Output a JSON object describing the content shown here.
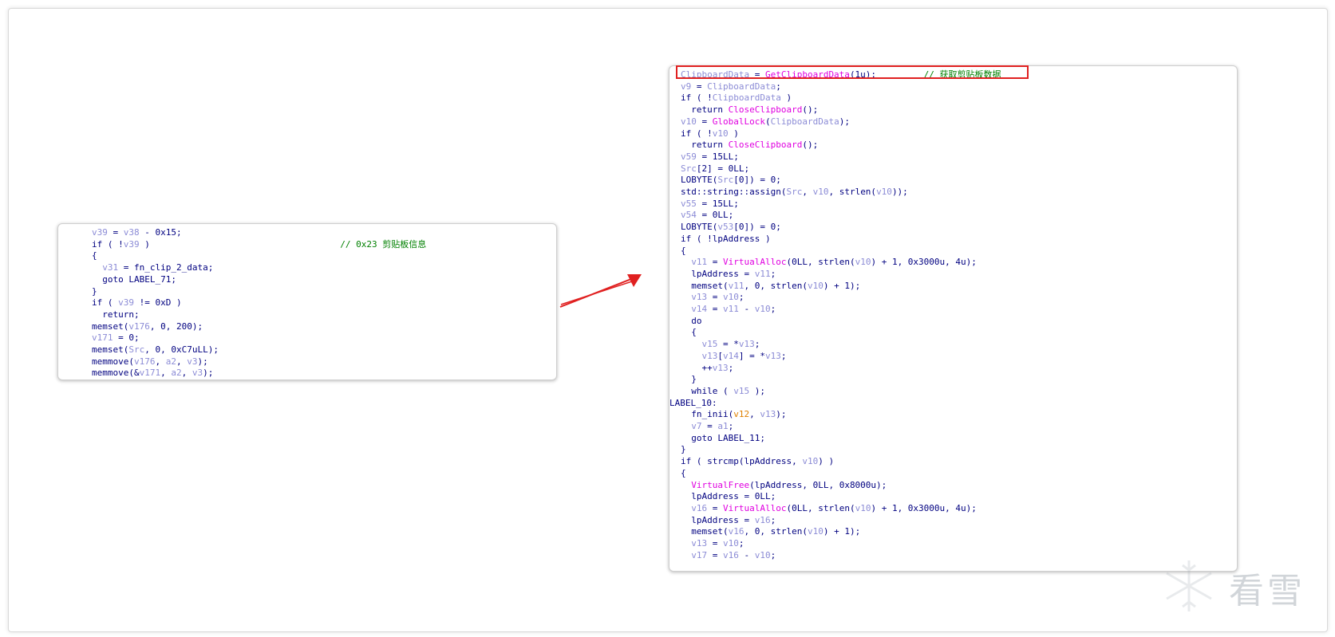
{
  "left_panel": {
    "lines": [
      [
        [
          "v39",
          "var"
        ],
        [
          " = ",
          "text"
        ],
        [
          "v38",
          "var"
        ],
        [
          " - 0x15;",
          "text"
        ]
      ],
      [
        [
          "if ( !",
          "text"
        ],
        [
          "v39",
          "var"
        ],
        [
          " )                                    ",
          "text"
        ],
        [
          "// 0x23 剪贴板信息",
          "comment"
        ]
      ],
      [
        [
          "{",
          "text"
        ]
      ],
      [
        [
          "  ",
          "text"
        ],
        [
          "v31",
          "var"
        ],
        [
          " = fn_clip_2_data;",
          "text"
        ]
      ],
      [
        [
          "  goto LABEL_71;",
          "text"
        ]
      ],
      [
        [
          "}",
          "text"
        ]
      ],
      [
        [
          "if ( ",
          "text"
        ],
        [
          "v39",
          "var"
        ],
        [
          " != 0xD )",
          "text"
        ]
      ],
      [
        [
          "  return;",
          "text"
        ]
      ],
      [
        [
          "memset(",
          "text"
        ],
        [
          "v176",
          "var"
        ],
        [
          ", 0, 200);",
          "text"
        ]
      ],
      [
        [
          "v171",
          "var"
        ],
        [
          " = 0;",
          "text"
        ]
      ],
      [
        [
          "memset(",
          "text"
        ],
        [
          "Src",
          "var"
        ],
        [
          ", 0, 0xC7uLL);",
          "text"
        ]
      ],
      [
        [
          "memmove(",
          "text"
        ],
        [
          "v176",
          "var"
        ],
        [
          ", ",
          "text"
        ],
        [
          "a2",
          "var"
        ],
        [
          ", ",
          "text"
        ],
        [
          "v3",
          "var"
        ],
        [
          ");",
          "text"
        ]
      ],
      [
        [
          "memmove(&",
          "text"
        ],
        [
          "v171",
          "var"
        ],
        [
          ", ",
          "text"
        ],
        [
          "a2",
          "var"
        ],
        [
          ", ",
          "text"
        ],
        [
          "v3",
          "var"
        ],
        [
          ");",
          "text"
        ]
      ]
    ]
  },
  "right_panel": {
    "lines": [
      [
        [
          "ClipboardData",
          "var"
        ],
        [
          " = ",
          "text"
        ],
        [
          "GetClipboardData",
          "func"
        ],
        [
          "(1u);         ",
          "text"
        ],
        [
          "// 获取剪贴板数据",
          "comment"
        ]
      ],
      [
        [
          "v9",
          "var"
        ],
        [
          " = ",
          "text"
        ],
        [
          "ClipboardData",
          "var"
        ],
        [
          ";",
          "text"
        ]
      ],
      [
        [
          "if ( !",
          "text"
        ],
        [
          "ClipboardData",
          "var"
        ],
        [
          " )",
          "text"
        ]
      ],
      [
        [
          "  return ",
          "text"
        ],
        [
          "CloseClipboard",
          "func"
        ],
        [
          "();",
          "text"
        ]
      ],
      [
        [
          "v10",
          "var"
        ],
        [
          " = ",
          "text"
        ],
        [
          "GlobalLock",
          "func"
        ],
        [
          "(",
          "text"
        ],
        [
          "ClipboardData",
          "var"
        ],
        [
          ");",
          "text"
        ]
      ],
      [
        [
          "if ( !",
          "text"
        ],
        [
          "v10",
          "var"
        ],
        [
          " )",
          "text"
        ]
      ],
      [
        [
          "  return ",
          "text"
        ],
        [
          "CloseClipboard",
          "func"
        ],
        [
          "();",
          "text"
        ]
      ],
      [
        [
          "v59",
          "var"
        ],
        [
          " = 15LL;",
          "text"
        ]
      ],
      [
        [
          "Src",
          "var"
        ],
        [
          "[2] = 0LL;",
          "text"
        ]
      ],
      [
        [
          "LOBYTE(",
          "text"
        ],
        [
          "Src",
          "var"
        ],
        [
          "[0]) = 0;",
          "text"
        ]
      ],
      [
        [
          "std::string::assign(",
          "text"
        ],
        [
          "Src",
          "var"
        ],
        [
          ", ",
          "text"
        ],
        [
          "v10",
          "var"
        ],
        [
          ", strlen(",
          "text"
        ],
        [
          "v10",
          "var"
        ],
        [
          "));",
          "text"
        ]
      ],
      [
        [
          "v55",
          "var"
        ],
        [
          " = 15LL;",
          "text"
        ]
      ],
      [
        [
          "v54",
          "var"
        ],
        [
          " = 0LL;",
          "text"
        ]
      ],
      [
        [
          "LOBYTE(",
          "text"
        ],
        [
          "v53",
          "var"
        ],
        [
          "[0]) = 0;",
          "text"
        ]
      ],
      [
        [
          "if ( !lpAddress )",
          "text"
        ]
      ],
      [
        [
          "{",
          "text"
        ]
      ],
      [
        [
          "  ",
          "text"
        ],
        [
          "v11",
          "var"
        ],
        [
          " = ",
          "text"
        ],
        [
          "VirtualAlloc",
          "func"
        ],
        [
          "(0LL, strlen(",
          "text"
        ],
        [
          "v10",
          "var"
        ],
        [
          ") + 1, 0x3000u, 4u);",
          "text"
        ]
      ],
      [
        [
          "  lpAddress = ",
          "text"
        ],
        [
          "v11",
          "var"
        ],
        [
          ";",
          "text"
        ]
      ],
      [
        [
          "  memset(",
          "text"
        ],
        [
          "v11",
          "var"
        ],
        [
          ", 0, strlen(",
          "text"
        ],
        [
          "v10",
          "var"
        ],
        [
          ") + 1);",
          "text"
        ]
      ],
      [
        [
          "  ",
          "text"
        ],
        [
          "v13",
          "var"
        ],
        [
          " = ",
          "text"
        ],
        [
          "v10",
          "var"
        ],
        [
          ";",
          "text"
        ]
      ],
      [
        [
          "  ",
          "text"
        ],
        [
          "v14",
          "var"
        ],
        [
          " = ",
          "text"
        ],
        [
          "v11",
          "var"
        ],
        [
          " - ",
          "text"
        ],
        [
          "v10",
          "var"
        ],
        [
          ";",
          "text"
        ]
      ],
      [
        [
          "  do",
          "text"
        ]
      ],
      [
        [
          "  {",
          "text"
        ]
      ],
      [
        [
          "    ",
          "text"
        ],
        [
          "v15",
          "var"
        ],
        [
          " = *",
          "text"
        ],
        [
          "v13",
          "var"
        ],
        [
          ";",
          "text"
        ]
      ],
      [
        [
          "    ",
          "text"
        ],
        [
          "v13",
          "var"
        ],
        [
          "[",
          "text"
        ],
        [
          "v14",
          "var"
        ],
        [
          "] = *",
          "text"
        ],
        [
          "v13",
          "var"
        ],
        [
          ";",
          "text"
        ]
      ],
      [
        [
          "    ++",
          "text"
        ],
        [
          "v13",
          "var"
        ],
        [
          ";",
          "text"
        ]
      ],
      [
        [
          "  }",
          "text"
        ]
      ],
      [
        [
          "  while ( ",
          "text"
        ],
        [
          "v15",
          "var"
        ],
        [
          " );",
          "text"
        ]
      ],
      [
        [
          "LABEL_10:",
          "text"
        ]
      ],
      [
        [
          "  fn_inii(",
          "text"
        ],
        [
          "v12",
          "orange"
        ],
        [
          ", ",
          "text"
        ],
        [
          "v13",
          "var"
        ],
        [
          ");",
          "text"
        ]
      ],
      [
        [
          "  ",
          "text"
        ],
        [
          "v7",
          "var"
        ],
        [
          " = ",
          "text"
        ],
        [
          "a1",
          "var"
        ],
        [
          ";",
          "text"
        ]
      ],
      [
        [
          "  goto LABEL_11;",
          "text"
        ]
      ],
      [
        [
          "}",
          "text"
        ]
      ],
      [
        [
          "if ( strcmp(lpAddress, ",
          "text"
        ],
        [
          "v10",
          "var"
        ],
        [
          ") )",
          "text"
        ]
      ],
      [
        [
          "{",
          "text"
        ]
      ],
      [
        [
          "  ",
          "text"
        ],
        [
          "VirtualFree",
          "func"
        ],
        [
          "(lpAddress, 0LL, 0x8000u);",
          "text"
        ]
      ],
      [
        [
          "  lpAddress = 0LL;",
          "text"
        ]
      ],
      [
        [
          "  ",
          "text"
        ],
        [
          "v16",
          "var"
        ],
        [
          " = ",
          "text"
        ],
        [
          "VirtualAlloc",
          "func"
        ],
        [
          "(0LL, strlen(",
          "text"
        ],
        [
          "v10",
          "var"
        ],
        [
          ") + 1, 0x3000u, 4u);",
          "text"
        ]
      ],
      [
        [
          "  lpAddress = ",
          "text"
        ],
        [
          "v16",
          "var"
        ],
        [
          ";",
          "text"
        ]
      ],
      [
        [
          "  memset(",
          "text"
        ],
        [
          "v16",
          "var"
        ],
        [
          ", 0, strlen(",
          "text"
        ],
        [
          "v10",
          "var"
        ],
        [
          ") + 1);",
          "text"
        ]
      ],
      [
        [
          "  ",
          "text"
        ],
        [
          "v13",
          "var"
        ],
        [
          " = ",
          "text"
        ],
        [
          "v10",
          "var"
        ],
        [
          ";",
          "text"
        ]
      ],
      [
        [
          "  ",
          "text"
        ],
        [
          "v17",
          "var"
        ],
        [
          " = ",
          "text"
        ],
        [
          "v16",
          "var"
        ],
        [
          " - ",
          "text"
        ],
        [
          "v10",
          "var"
        ],
        [
          ";",
          "text"
        ]
      ]
    ]
  },
  "watermark": {
    "text": "看雪"
  },
  "colors": {
    "plain": "#000080",
    "variable": "#8c8cd6",
    "function": "#e000e0",
    "comment": "#008000",
    "highlight_box": "#e02020",
    "arrow": "#e02020"
  },
  "icons": [
    "snowflake-watermark-icon",
    "arrow-icon"
  ]
}
